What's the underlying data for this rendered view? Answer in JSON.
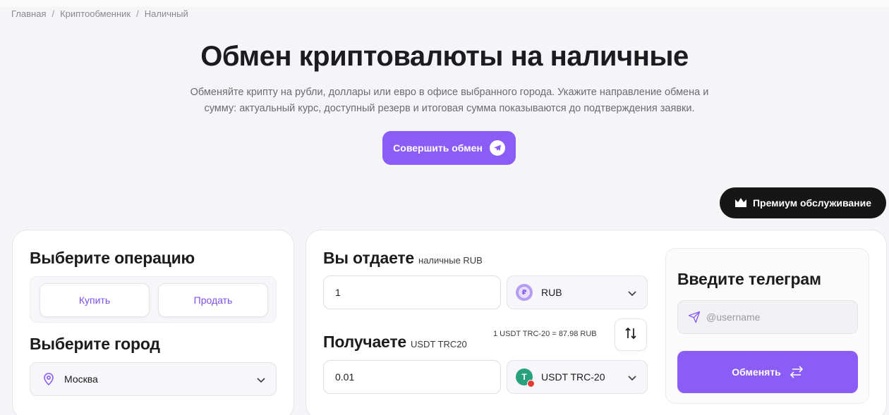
{
  "breadcrumb": [
    "Главная",
    "Криптообменник",
    "Наличный"
  ],
  "hero": {
    "title": "Обмен криптовалюты на наличные",
    "subtitle_line1": "Обменяйте крипту на рубли, доллары или евро в офисе выбранного города. Укажите направление обмена и",
    "subtitle_line2": "сумму: актуальный курс, доступный резерв и итоговая сумма показываются до подтверждения заявки.",
    "cta_label": "Совершить обмен"
  },
  "premium": {
    "label": "Премиум обслуживание"
  },
  "operation": {
    "title": "Выберите операцию",
    "buy_label": "Купить",
    "sell_label": "Продать"
  },
  "city": {
    "title": "Выберите город",
    "selected": "Москва"
  },
  "give": {
    "title": "Вы отдаете",
    "subtitle": "наличные RUB",
    "amount": "1",
    "currency": "RUB"
  },
  "receive": {
    "title": "Получаете",
    "subtitle": "USDT TRC20",
    "amount": "0.01",
    "currency": "USDT TRC-20",
    "rate": "1 USDT TRC-20 = 87.98 RUB"
  },
  "telegram": {
    "title": "Введите телеграм",
    "placeholder": "@username",
    "submit_label": "Обменять"
  },
  "colors": {
    "accent": "#8b5cf6",
    "dark": "#161616",
    "tether": "#26a17b"
  }
}
